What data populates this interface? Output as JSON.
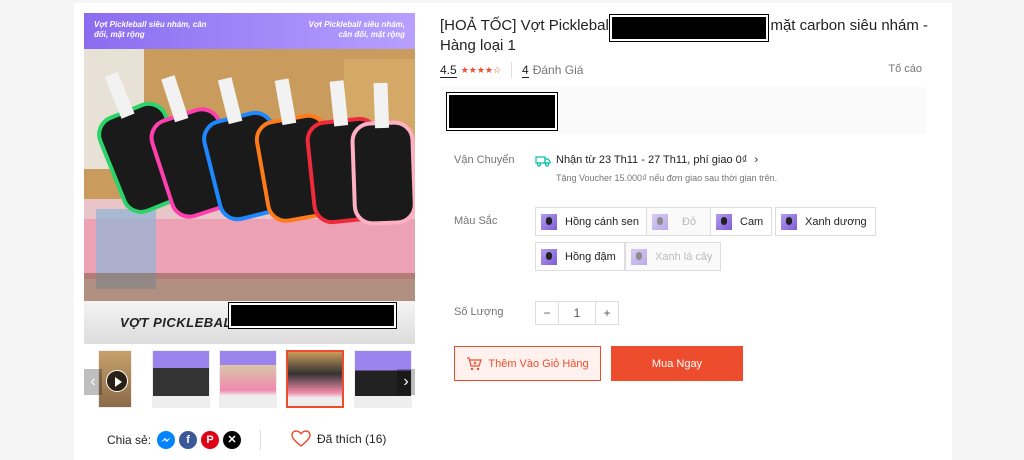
{
  "gallery": {
    "banner_left": "Vợt Pickleball siêu nhám, cân đối, mặt rộng",
    "banner_right": "Vợt Pickleball siêu nhám, cân đối, mặt rộng",
    "caption": "VỢT PICKLEBALL",
    "thumbnail_count": 5,
    "active_thumbnail": 4,
    "prev_icon": "chevron-left-icon",
    "next_icon": "chevron-right-icon"
  },
  "share": {
    "label": "Chia sẻ:",
    "icons": [
      "messenger-icon",
      "facebook-icon",
      "pinterest-icon",
      "x-icon"
    ]
  },
  "like": {
    "label": "Đã thích (16)"
  },
  "product": {
    "title_part1": "[HOẢ TỐC] Vợt Pickleball",
    "title_part2": "mặt carbon siêu nhám - Hàng loại 1",
    "rating": "4.5",
    "rating_value": 4.5,
    "review_count": "4",
    "review_label": "Đánh Giá",
    "report": "Tố cáo"
  },
  "shipping": {
    "label": "Vận Chuyển",
    "main": "Nhận từ 23 Th11 - 27 Th11, phí giao 0₫",
    "sub": "Tặng Voucher 15.000₫ nếu đơn giao sau thời gian trên."
  },
  "color": {
    "label": "Màu Sắc",
    "options": [
      {
        "label": "Hồng cánh sen",
        "enabled": true
      },
      {
        "label": "Đỏ",
        "enabled": false
      },
      {
        "label": "Cam",
        "enabled": true
      },
      {
        "label": "Xanh dương",
        "enabled": true
      },
      {
        "label": "Hồng đậm",
        "enabled": true
      },
      {
        "label": "Xanh lá cây",
        "enabled": false
      }
    ]
  },
  "quantity": {
    "label": "Số Lượng",
    "minus": "−",
    "value": "1",
    "plus": "+"
  },
  "actions": {
    "add_to_cart": "Thêm Vào Giỏ Hàng",
    "buy_now": "Mua Ngay"
  },
  "colors": {
    "accent": "#ee4d2d",
    "accent_light": "#fff1ee"
  }
}
